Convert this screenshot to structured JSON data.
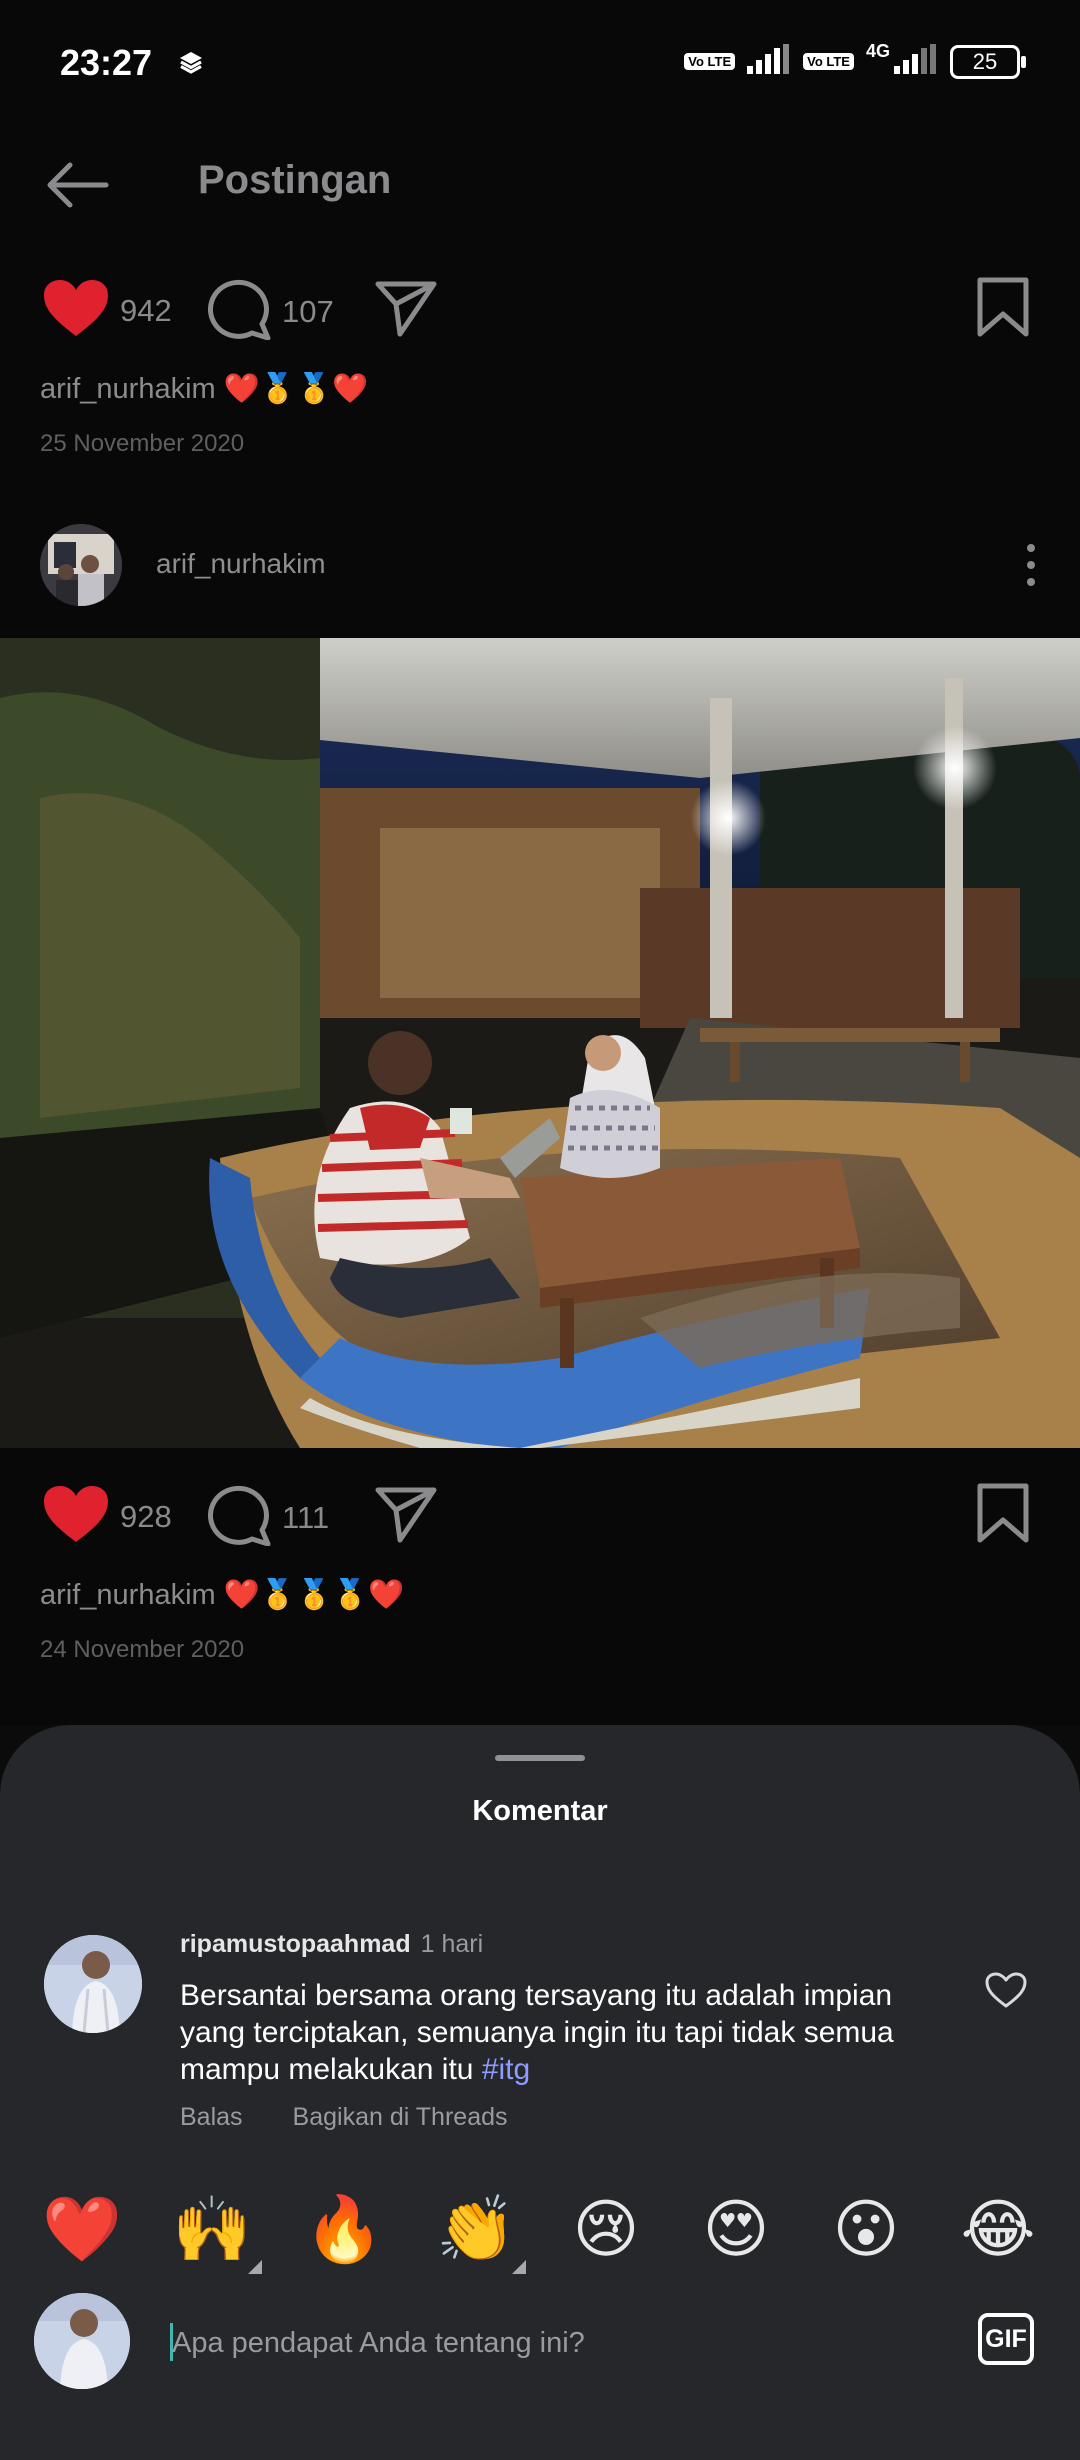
{
  "status_bar": {
    "time": "23:27",
    "volte_1": "Vo LTE",
    "volte_2": "Vo LTE",
    "network": "4G",
    "battery": "25"
  },
  "header": {
    "title": "Postingan"
  },
  "post_top": {
    "likes": "942",
    "comments": "107",
    "caption_user": "arif_nurhakim",
    "caption_emoji": "❤️🥇🥇❤️",
    "date": "25 November 2020"
  },
  "post": {
    "author": "arif_nurhakim",
    "likes": "928",
    "comments": "111",
    "caption_user": "arif_nurhakim",
    "caption_emoji": "❤️🥇🥇🥇❤️",
    "date": "24 November 2020"
  },
  "comments_sheet": {
    "title": "Komentar",
    "comment": {
      "username": "ripamustopaahmad",
      "time": "1 hari",
      "text": "Bersantai bersama orang tersayang itu adalah impian yang terciptakan, semuanya ingin itu tapi tidak semua mampu melakukan itu ",
      "hashtag": "#itg",
      "reply_label": "Balas",
      "share_label": "Bagikan di Threads"
    },
    "emojis": [
      "❤️",
      "🙌",
      "🔥",
      "👏",
      "😢",
      "😍",
      "😮",
      "😂"
    ],
    "input_placeholder": "Apa pendapat Anda tentang ini?",
    "gif_label": "GIF"
  },
  "colors": {
    "heart_red": "#e0222e",
    "hashtag_blue": "#8e9bff",
    "sheet_bg": "#25272b"
  }
}
